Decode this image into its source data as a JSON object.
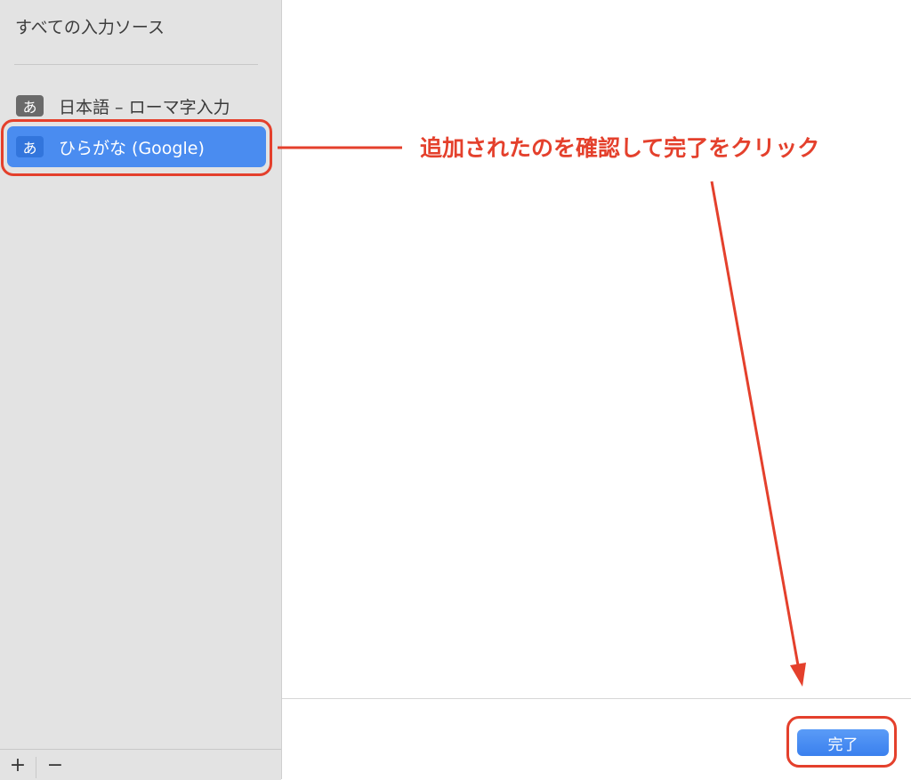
{
  "sidebar": {
    "header": "すべての入力ソース",
    "items": [
      {
        "badge": "あ",
        "label": "日本語 – ローマ字入力",
        "selected": false
      },
      {
        "badge": "あ",
        "label": "ひらがな (Google)",
        "selected": true
      }
    ],
    "footer": {
      "add_label": "+",
      "remove_label": "−"
    }
  },
  "content": {
    "done_label": "完了"
  },
  "annotation": {
    "text": "追加されたのを確認して完了をクリック",
    "color": "#e4402c"
  },
  "colors": {
    "selection": "#4a8cf0",
    "button": "#3a80ee"
  }
}
